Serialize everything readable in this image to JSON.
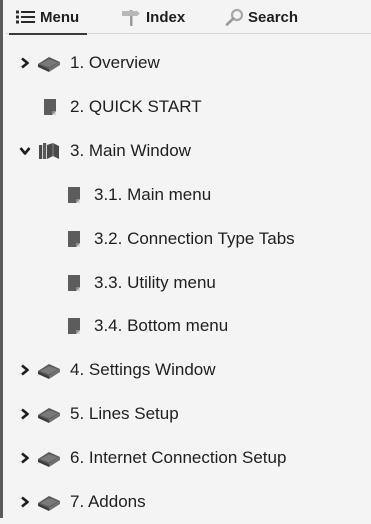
{
  "tabs": [
    {
      "label": "Menu",
      "icon": "list-icon",
      "active": true
    },
    {
      "label": "Index",
      "icon": "signpost-icon",
      "active": false
    },
    {
      "label": "Search",
      "icon": "magnifier-icon",
      "active": false
    }
  ],
  "tree": [
    {
      "label": "1. Overview",
      "type": "book",
      "state": "collapsed"
    },
    {
      "label": "2. QUICK START",
      "type": "page",
      "state": "leaf"
    },
    {
      "label": "3. Main Window",
      "type": "book-open",
      "state": "expanded"
    },
    {
      "label": "3.1. Main menu",
      "type": "page",
      "state": "leaf"
    },
    {
      "label": "3.2. Connection Type Tabs",
      "type": "page",
      "state": "leaf"
    },
    {
      "label": "3.3. Utility menu",
      "type": "page",
      "state": "leaf"
    },
    {
      "label": "3.4. Bottom menu",
      "type": "page",
      "state": "leaf"
    },
    {
      "label": "4. Settings Window",
      "type": "book",
      "state": "collapsed"
    },
    {
      "label": "5. Lines Setup",
      "type": "book",
      "state": "collapsed"
    },
    {
      "label": "6. Internet Connection Setup",
      "type": "book",
      "state": "collapsed"
    },
    {
      "label": "7. Addons",
      "type": "book",
      "state": "collapsed"
    }
  ],
  "colors": {
    "icon": "#4a4a4a",
    "text": "#202020",
    "background": "#f4f4f4"
  }
}
